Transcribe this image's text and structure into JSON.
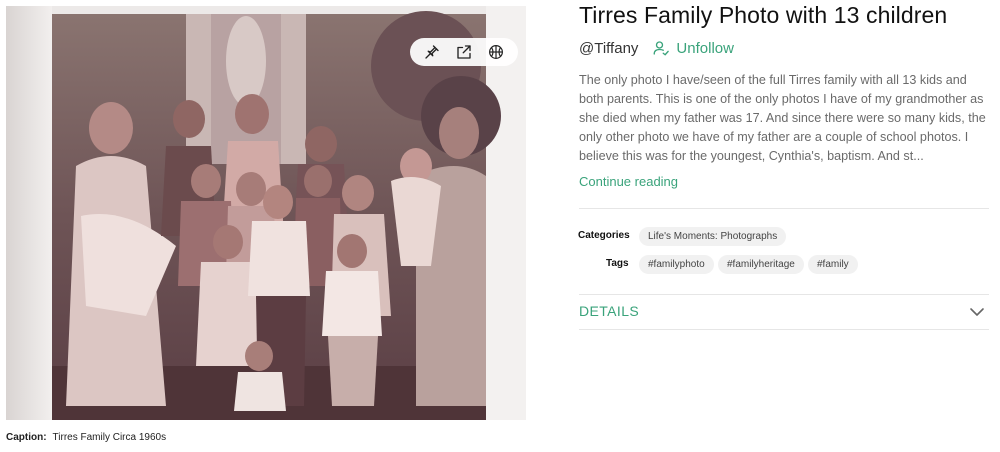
{
  "post": {
    "title": "Tirres Family Photo with 13 children",
    "author": "@Tiffany",
    "follow_label": "Unfollow",
    "description": "The only photo I have/seen of the full Tirres family with all 13 kids and both parents. This is one of the only photos I have of my grandmother as she died when my father was 17. And since there were so many kids, the only other photo we have of my father are a couple of school photos. I believe this was for the youngest, Cynthia's, baptism. And st...",
    "continue_label": "Continue reading",
    "categories_label": "Categories",
    "categories": [
      "Life's Moments: Photographs"
    ],
    "tags_label": "Tags",
    "tags": [
      "#familyphoto",
      "#familyheritage",
      "#family"
    ],
    "details_label": "DETAILS"
  },
  "photo": {
    "toolbar_icons": [
      "pin-icon",
      "share-icon",
      "basketball-icon"
    ],
    "caption_label": "Caption:",
    "caption": "Tirres Family Circa 1960s"
  },
  "colors": {
    "accent": "#3aa37b",
    "text_muted": "#6a6a6a",
    "chip_bg": "#f1f1f1"
  }
}
